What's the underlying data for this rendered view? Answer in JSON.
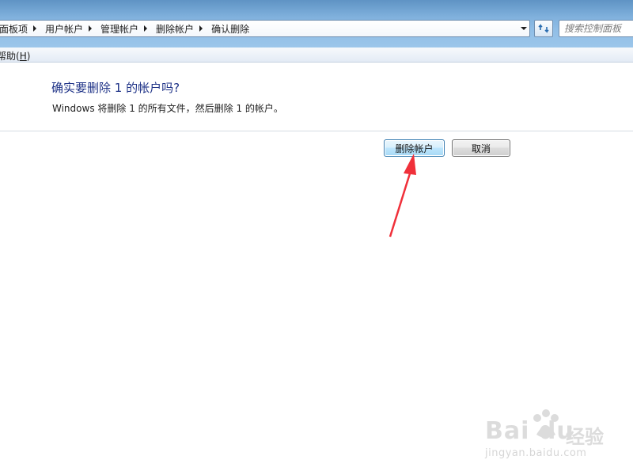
{
  "address_bar": {
    "crumbs": [
      "面板项",
      "用户帐户",
      "管理帐户",
      "删除帐户",
      "确认删除"
    ]
  },
  "search": {
    "placeholder": "搜索控制面板"
  },
  "menu": {
    "help_prefix": "帮助(",
    "help_key": "H",
    "help_suffix": ")"
  },
  "dialog": {
    "heading": "确实要删除 1 的帐户吗?",
    "description": "Windows 将删除 1 的所有文件，然后删除 1 的帐户。",
    "delete_button": "删除帐户",
    "cancel_button": "取消"
  },
  "annotation": {
    "arrow_color": "#f0303a"
  },
  "watermark": {
    "logo": "Bai du",
    "text": "经验",
    "url": "jingyan.baidu.com"
  },
  "colors": {
    "heading": "#1e3287",
    "frame": "#7fb0dc"
  }
}
